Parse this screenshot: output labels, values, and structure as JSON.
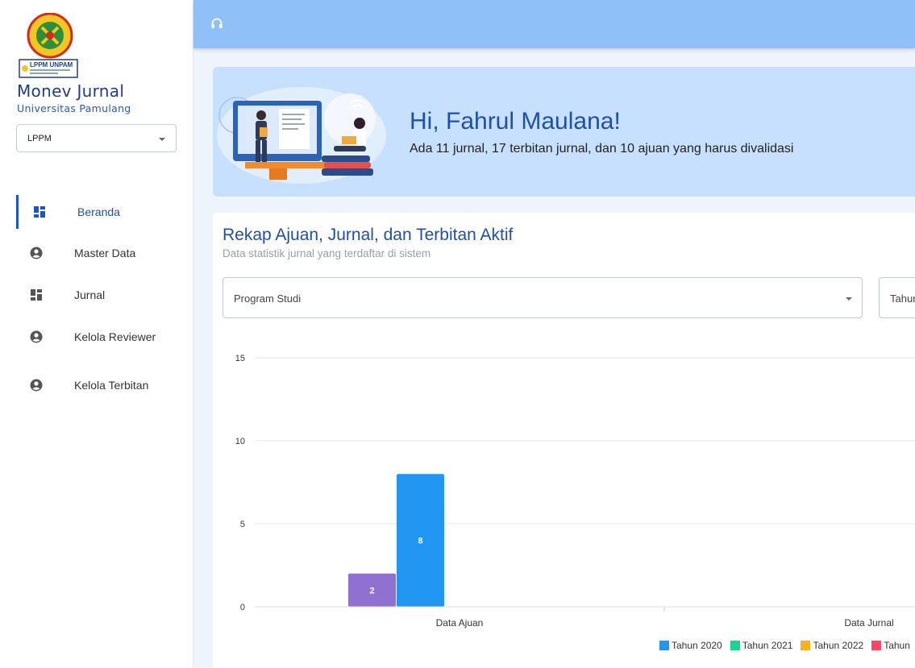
{
  "sidebar": {
    "logo_text": "LPPM UNPAM",
    "app_title": "Monev Jurnal",
    "app_subtitle": "Universitas Pamulang",
    "role_select": "LPPM",
    "items": [
      {
        "label": "Beranda",
        "icon": "dashboard-icon",
        "active": true
      },
      {
        "label": "Master Data",
        "icon": "account-circle-icon"
      },
      {
        "label": "Jurnal",
        "icon": "dashboard-icon"
      },
      {
        "label": "Kelola Reviewer",
        "icon": "account-circle-icon"
      },
      {
        "label": "Kelola Terbitan",
        "icon": "account-circle-icon"
      }
    ]
  },
  "topbar": {
    "icon": "headset-icon"
  },
  "banner": {
    "greeting": "Hi, Fahrul Maulana!",
    "message": "Ada 11 jurnal, 17 terbitan jurnal, dan 10 ajuan yang harus divalidasi"
  },
  "card": {
    "title": "Rekap Ajuan, Jurnal, dan Terbitan Aktif",
    "subtitle": "Data statistik jurnal yang terdaftar di sistem",
    "filter_program": "Program Studi",
    "filter_year": "Tahun"
  },
  "colors": {
    "Tahun 2019": "#9070d0",
    "Tahun 2020": "#2196f3",
    "Tahun 2021": "#19d58f",
    "Tahun 2022": "#fbb11c",
    "Tahun 2023": "#ff4560"
  },
  "chart_data": {
    "type": "bar",
    "categories": [
      "Data Ajuan",
      "Data Jurnal"
    ],
    "series": [
      {
        "name": "",
        "values": [
          2,
          null
        ]
      },
      {
        "name": "Tahun 2020",
        "values": [
          8,
          null
        ]
      },
      {
        "name": "Tahun 2021",
        "values": [
          null,
          null
        ]
      },
      {
        "name": "Tahun 2022",
        "values": [
          null,
          null
        ]
      },
      {
        "name": "Tahun",
        "values": [
          null,
          null
        ]
      }
    ],
    "yticks": [
      0,
      5,
      10,
      15
    ],
    "ylim": [
      0,
      15
    ],
    "legend": [
      "Tahun 2020",
      "Tahun 2021",
      "Tahun 2022",
      "Tahun"
    ],
    "legend_placement": "bottom-right",
    "grid": true
  }
}
